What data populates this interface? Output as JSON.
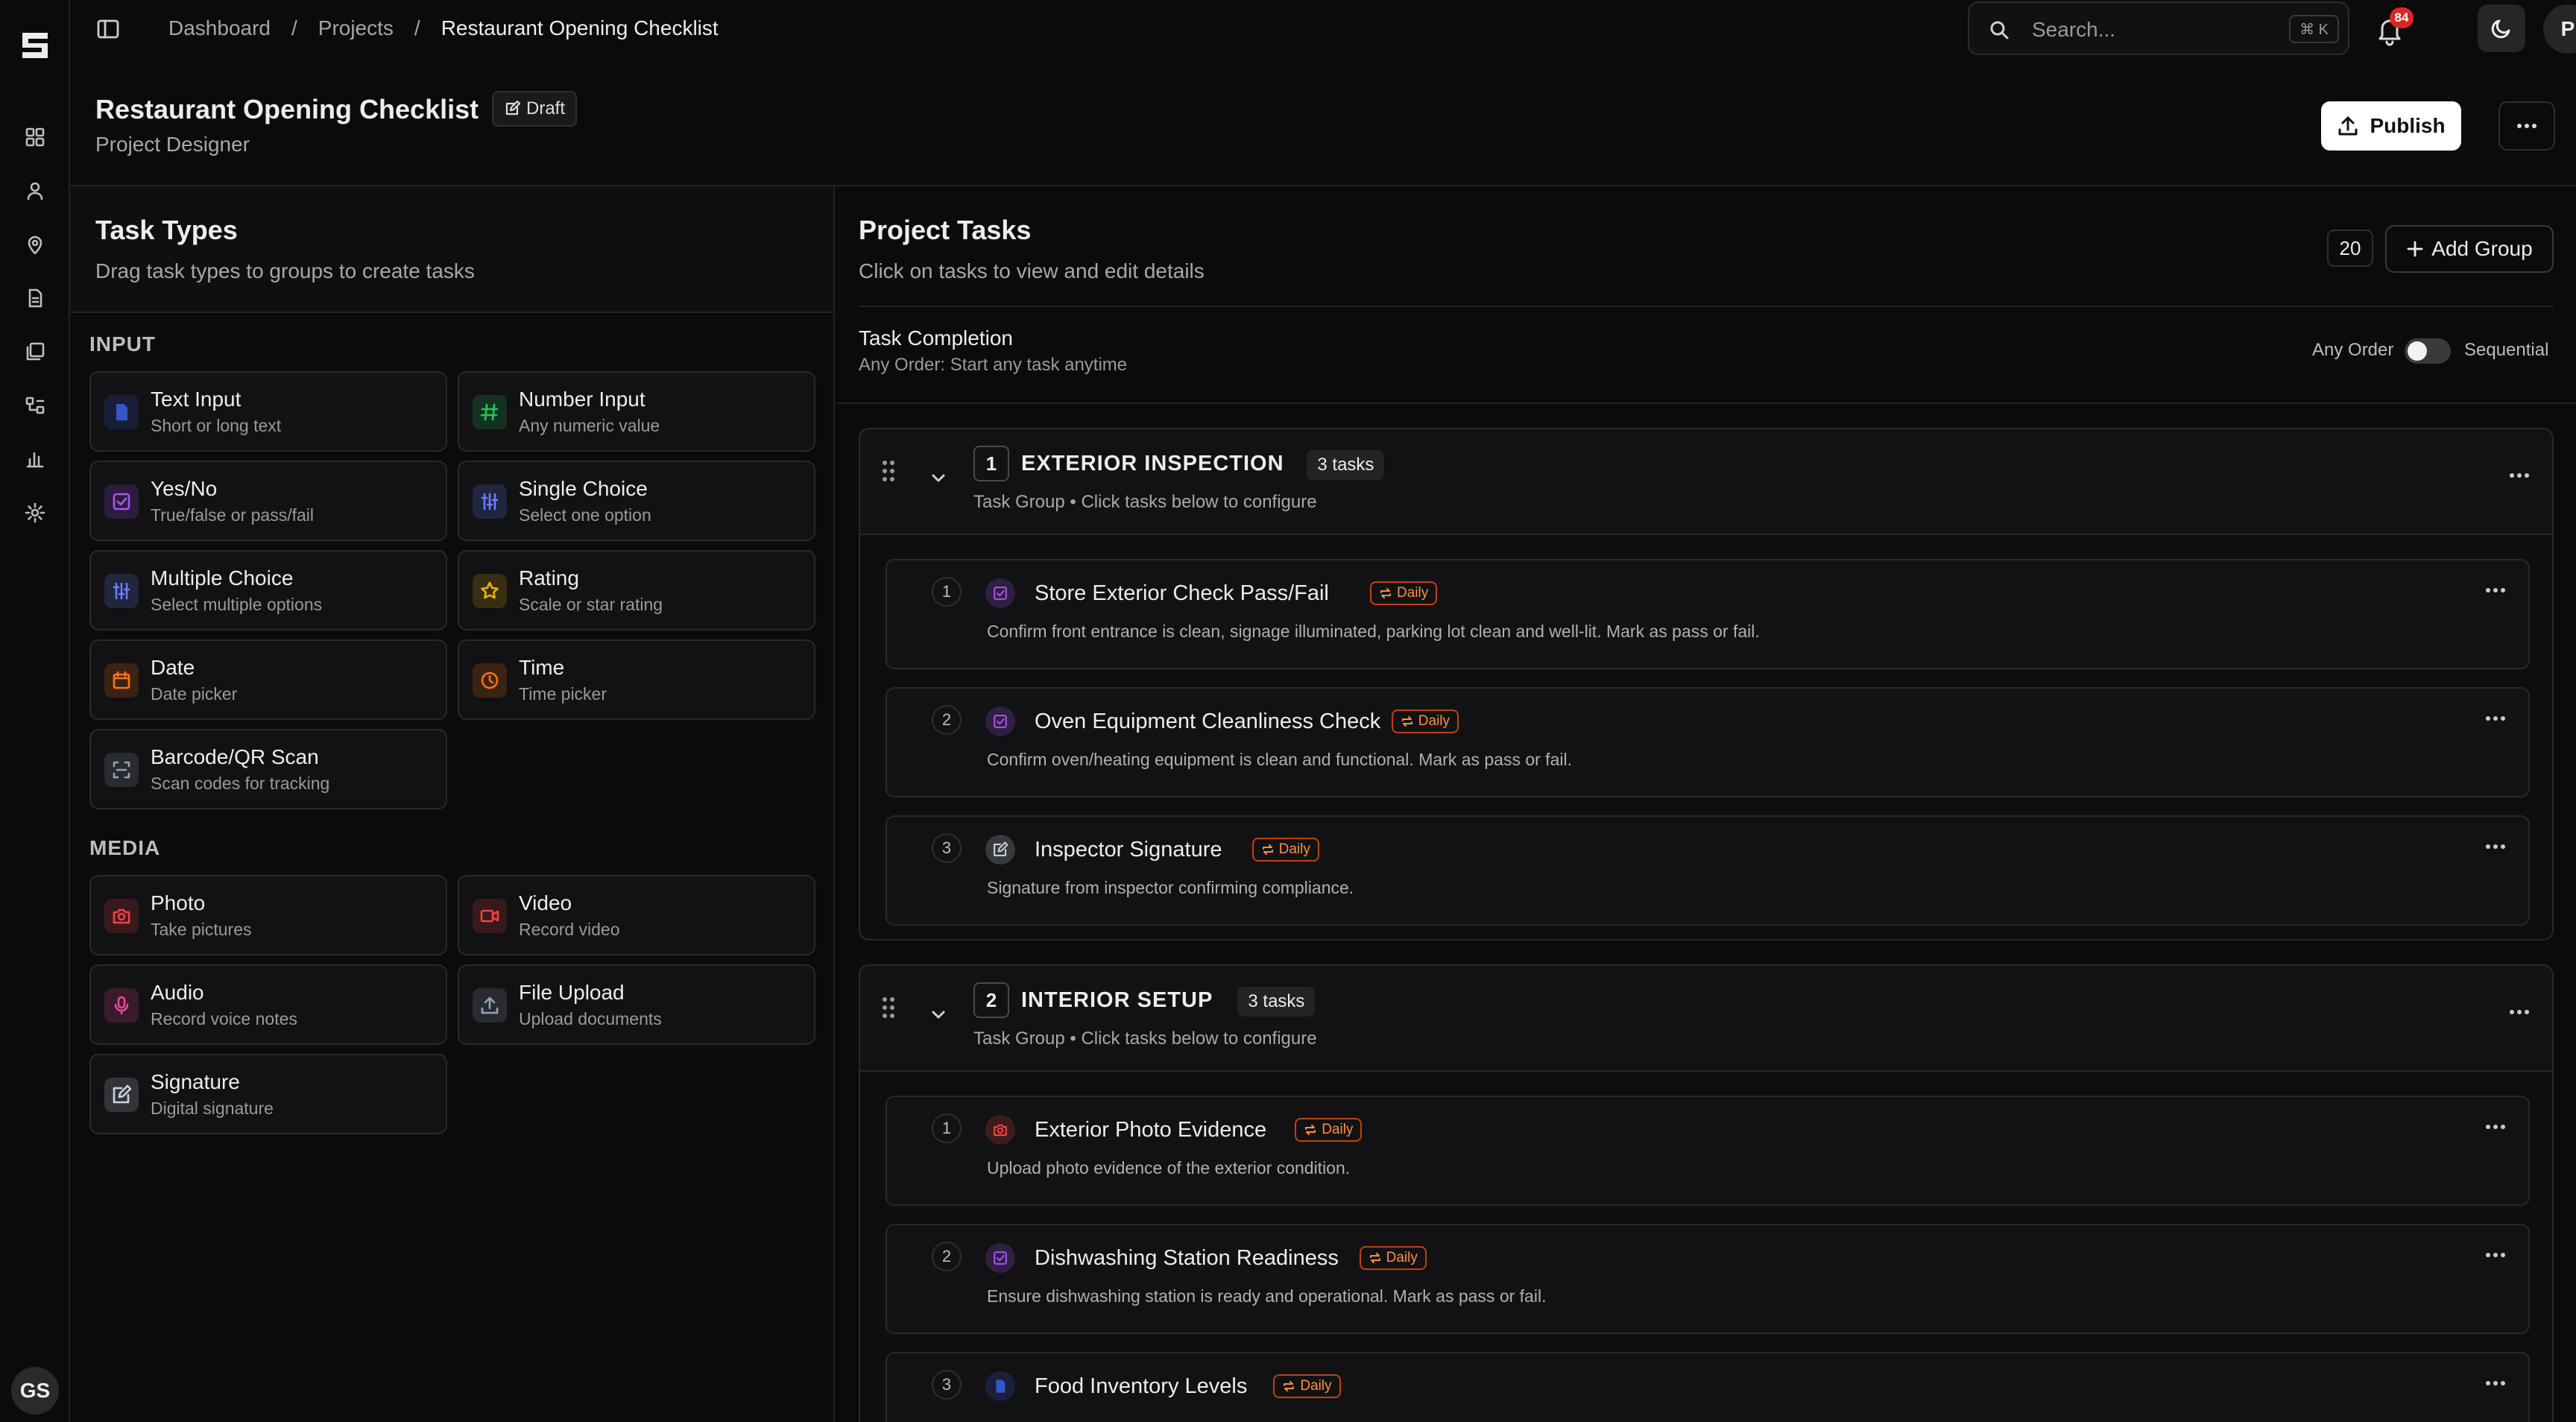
{
  "rail_user": "GS",
  "breadcrumbs": [
    "Dashboard",
    "Projects",
    "Restaurant Opening Checklist"
  ],
  "search": {
    "placeholder": "Search...",
    "shortcut": "⌘ K"
  },
  "notifications": {
    "count": "84"
  },
  "user_initial": "P",
  "page": {
    "title": "Restaurant Opening Checklist",
    "status": "Draft",
    "subtitle": "Project Designer",
    "publish_label": "Publish"
  },
  "task_types": {
    "title": "Task Types",
    "subtitle": "Drag task types to groups to create tasks",
    "sections": [
      {
        "label": "INPUT",
        "items": [
          {
            "name": "Text Input",
            "desc": "Short or long text",
            "icon": "document-icon",
            "color": "#3b5bdb"
          },
          {
            "name": "Number Input",
            "desc": "Any numeric value",
            "icon": "hash-icon",
            "color": "#22c55e"
          },
          {
            "name": "Yes/No",
            "desc": "True/false or pass/fail",
            "icon": "check-square-icon",
            "color": "#a855f7"
          },
          {
            "name": "Single Choice",
            "desc": "Select one option",
            "icon": "sliders-icon",
            "color": "#6b7dff"
          },
          {
            "name": "Multiple Choice",
            "desc": "Select multiple options",
            "icon": "sliders-icon",
            "color": "#6b7dff"
          },
          {
            "name": "Rating",
            "desc": "Scale or star rating",
            "icon": "star-icon",
            "color": "#eab308"
          },
          {
            "name": "Date",
            "desc": "Date picker",
            "icon": "calendar-icon",
            "color": "#f97316"
          },
          {
            "name": "Time",
            "desc": "Time picker",
            "icon": "clock-icon",
            "color": "#f97316"
          },
          {
            "name": "Barcode/QR Scan",
            "desc": "Scan codes for tracking",
            "icon": "scan-icon",
            "color": "#94a3b8"
          }
        ]
      },
      {
        "label": "MEDIA",
        "items": [
          {
            "name": "Photo",
            "desc": "Take pictures",
            "icon": "camera-icon",
            "color": "#ef4444"
          },
          {
            "name": "Video",
            "desc": "Record video",
            "icon": "video-icon",
            "color": "#ef4444"
          },
          {
            "name": "Audio",
            "desc": "Record voice notes",
            "icon": "mic-icon",
            "color": "#ec4899"
          },
          {
            "name": "File Upload",
            "desc": "Upload documents",
            "icon": "upload-icon",
            "color": "#94a3b8"
          },
          {
            "name": "Signature",
            "desc": "Digital signature",
            "icon": "pen-icon",
            "color": "#cbd5e1"
          }
        ]
      }
    ]
  },
  "project_tasks": {
    "title": "Project Tasks",
    "subtitle": "Click on tasks to view and edit details",
    "count": "20",
    "add_group_label": "Add Group",
    "completion_title": "Task Completion",
    "completion_sub": "Any Order: Start any task anytime",
    "any_order": "Any Order",
    "sequential": "Sequential",
    "sequential_on": false,
    "groups": [
      {
        "num": "1",
        "name": "EXTERIOR INSPECTION",
        "count": "3 tasks",
        "sub": "Task Group • Click tasks below to configure",
        "tasks": [
          {
            "num": "1",
            "name": "Store Exterior Check Pass/Fail",
            "badge": "Daily",
            "desc": "Confirm front entrance is clean, signage illuminated, parking lot clean and well-lit. Mark as pass or fail.",
            "icon": "check-square-icon",
            "color": "#a855f7"
          },
          {
            "num": "2",
            "name": "Oven Equipment Cleanliness Check",
            "badge": "Daily",
            "desc": "Confirm oven/heating equipment is clean and functional. Mark as pass or fail.",
            "icon": "check-square-icon",
            "color": "#a855f7"
          },
          {
            "num": "3",
            "name": "Inspector Signature",
            "badge": "Daily",
            "desc": "Signature from inspector confirming compliance.",
            "icon": "pen-icon",
            "color": "#cbd5e1"
          }
        ]
      },
      {
        "num": "2",
        "name": "INTERIOR SETUP",
        "count": "3 tasks",
        "sub": "Task Group • Click tasks below to configure",
        "tasks": [
          {
            "num": "1",
            "name": "Exterior Photo Evidence",
            "badge": "Daily",
            "desc": "Upload photo evidence of the exterior condition.",
            "icon": "camera-icon",
            "color": "#ef4444"
          },
          {
            "num": "2",
            "name": "Dishwashing Station Readiness",
            "badge": "Daily",
            "desc": "Ensure dishwashing station is ready and operational. Mark as pass or fail.",
            "icon": "check-square-icon",
            "color": "#a855f7"
          },
          {
            "num": "3",
            "name": "Food Inventory Levels",
            "badge": "Daily",
            "desc": "",
            "icon": "document-icon",
            "color": "#3b5bdb"
          }
        ]
      }
    ]
  }
}
